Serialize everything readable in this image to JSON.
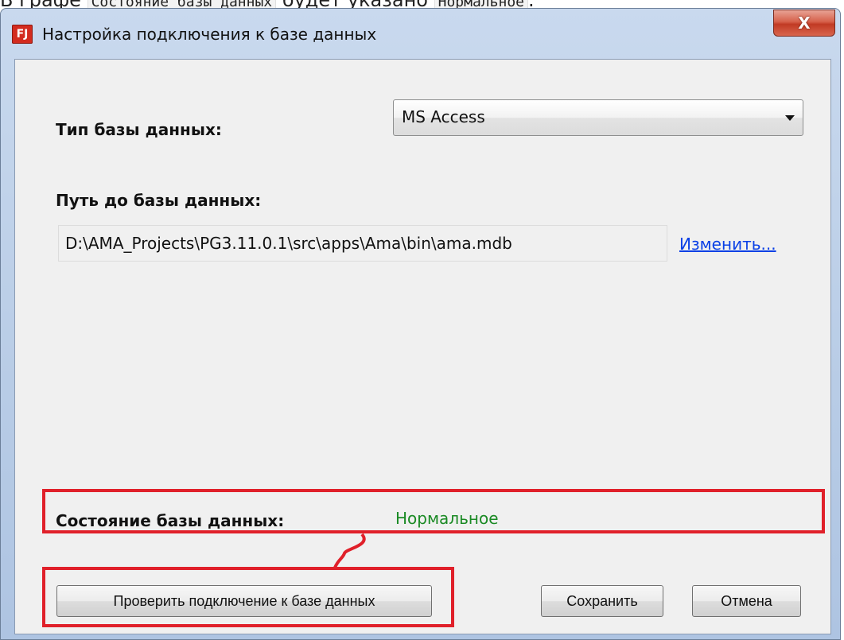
{
  "page": {
    "text_before": "В графе ",
    "code1": "Состояние базы данных",
    "text_middle": " будет указано ",
    "code2": "Нормальное",
    "text_after": "."
  },
  "window": {
    "icon_letters": "FJ",
    "title": "Настройка подключения к базе данных",
    "close_label": "X"
  },
  "form": {
    "db_type_label": "Тип базы данных:",
    "db_type_value": "MS Access",
    "db_path_label": "Путь до базы данных:",
    "db_path_value": "D:\\AMA_Projects\\PG3.11.0.1\\src\\apps\\Ama\\bin\\ama.mdb",
    "change_link": "Изменить...",
    "status_label": "Состояние базы данных:",
    "status_value": "Нормальное"
  },
  "buttons": {
    "check_connection": "Проверить подключение к базе данных",
    "save": "Сохранить",
    "cancel": "Отмена"
  },
  "colors": {
    "status_ok": "#1a8a24",
    "highlight": "#e0202a",
    "link": "#0a40e6"
  }
}
